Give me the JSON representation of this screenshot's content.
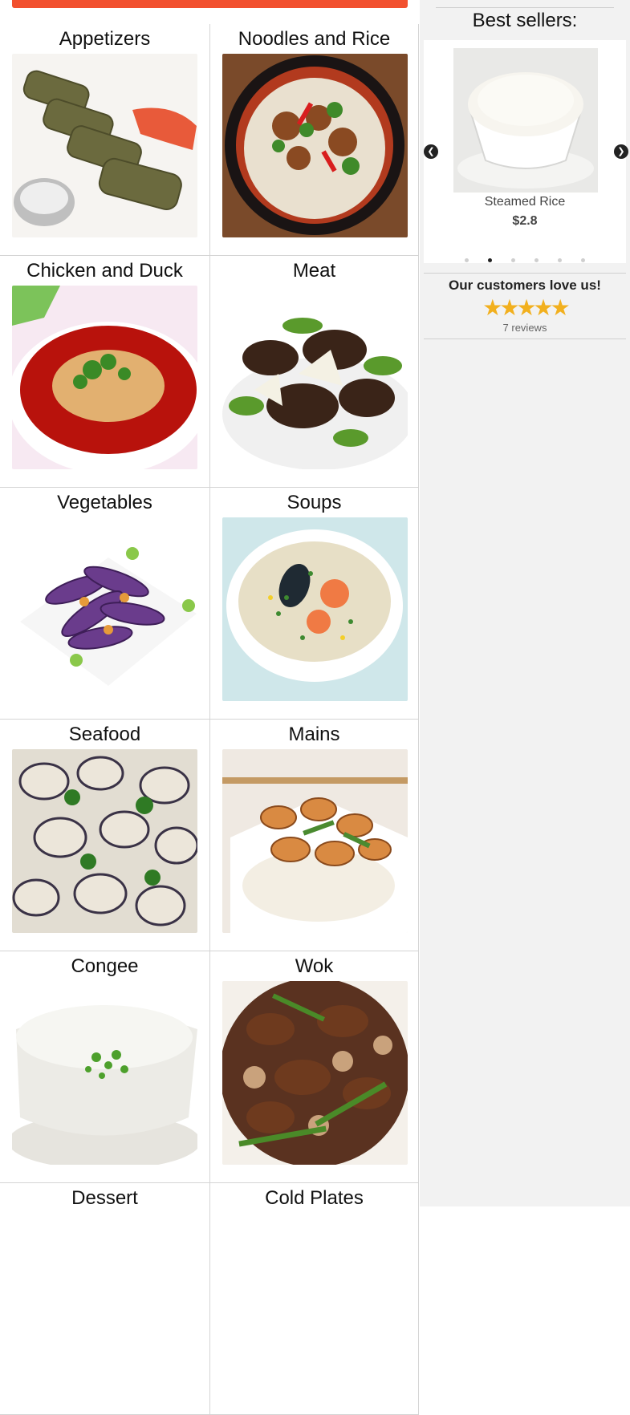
{
  "categories": [
    {
      "name": "Appetizers"
    },
    {
      "name": "Noodles and Rice"
    },
    {
      "name": "Chicken and Duck"
    },
    {
      "name": "Meat"
    },
    {
      "name": "Vegetables"
    },
    {
      "name": "Soups"
    },
    {
      "name": "Seafood"
    },
    {
      "name": "Mains"
    },
    {
      "name": "Congee"
    },
    {
      "name": "Wok"
    },
    {
      "name": "Dessert"
    },
    {
      "name": "Cold Plates"
    }
  ],
  "sidebar": {
    "best_title": "Best sellers:",
    "carousel": {
      "item_name": "Steamed Rice",
      "item_price": "$2.8",
      "prev_icon": "chevron-left-icon",
      "next_icon": "chevron-right-icon",
      "dot_count": 6,
      "active_dot": 1
    },
    "reviews": {
      "title": "Our customers love us!",
      "stars": "★★★★★",
      "count": "7 reviews"
    }
  },
  "colors": {
    "accent": "#f2502e",
    "star": "#f2b01e"
  }
}
